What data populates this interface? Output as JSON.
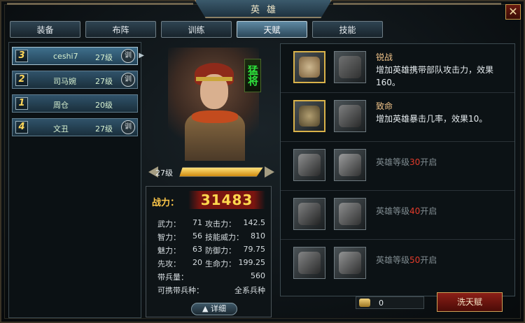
{
  "window": {
    "title": "英雄",
    "close_label": "✕"
  },
  "tabs": [
    {
      "label": "装备",
      "active": false
    },
    {
      "label": "布阵",
      "active": false
    },
    {
      "label": "训练",
      "active": false
    },
    {
      "label": "天赋",
      "active": true
    },
    {
      "label": "技能",
      "active": false
    }
  ],
  "heroes": [
    {
      "rank": "3",
      "name": "ceshi7",
      "level": "27级",
      "train": "训",
      "selected": true
    },
    {
      "rank": "2",
      "name": "司马婉",
      "level": "27级",
      "train": "训",
      "selected": false
    },
    {
      "rank": "1",
      "name": "周仓",
      "level": "20级",
      "train": "",
      "selected": false
    },
    {
      "rank": "4",
      "name": "文丑",
      "level": "27级",
      "train": "训",
      "selected": false
    }
  ],
  "portrait": {
    "rank_tag": "猛将"
  },
  "level": {
    "label": "27级",
    "progress": 1.0
  },
  "stats": {
    "power_label": "战力：",
    "power_value": "31483",
    "rows": [
      {
        "a": "武力：",
        "av": "71",
        "b": "攻击力：",
        "bv": "142.5"
      },
      {
        "a": "智力：",
        "av": "56",
        "b": "技能威力：",
        "bv": "810"
      },
      {
        "a": "魅力：",
        "av": "63",
        "b": "防御力：",
        "bv": "79.75"
      },
      {
        "a": "先攻：",
        "av": "20",
        "b": "生命力：",
        "bv": "199.25"
      },
      {
        "a": "带兵量：",
        "av": "",
        "b": "",
        "bv": "560"
      },
      {
        "a": "可携带兵种：",
        "av": "",
        "b": "",
        "bv": "全系兵种"
      }
    ],
    "detail_label": "▲ 详细"
  },
  "talents": [
    {
      "name": "锐战",
      "desc": "增加英雄携带部队攻击力，效果160。",
      "lock": ""
    },
    {
      "name": "致命",
      "desc": "增加英雄暴击几率，效果10。",
      "lock": ""
    },
    {
      "name": "",
      "desc": "",
      "lock_pre": "英雄等级",
      "lock_num": "30",
      "lock_post": "开启"
    },
    {
      "name": "",
      "desc": "",
      "lock_pre": "英雄等级",
      "lock_num": "40",
      "lock_post": "开启"
    },
    {
      "name": "",
      "desc": "",
      "lock_pre": "英雄等级",
      "lock_num": "50",
      "lock_post": "开启"
    }
  ],
  "footer": {
    "currency_value": "0",
    "wash_label": "洗天赋"
  },
  "colors": {
    "accent_gold": "#d9b24a",
    "tab_active": "#5f8aa4",
    "lock_red": "#e33b2b",
    "power_red": "#7a1510"
  }
}
